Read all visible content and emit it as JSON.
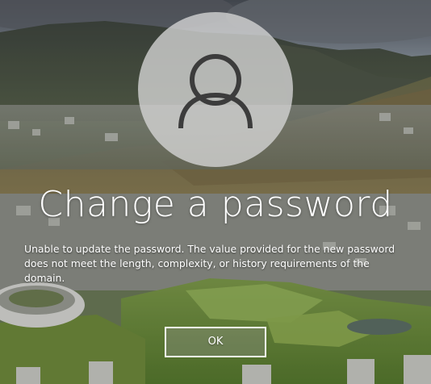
{
  "screen": {
    "title": "Change a password",
    "message": "Unable to update the password. The value provided for the new password does not meet the length, complexity, or history requirements of the domain.",
    "ok_label": "OK"
  },
  "avatar": {
    "icon": "user-icon"
  },
  "colors": {
    "text": "#ffffff",
    "button_border": "#ffffff",
    "avatar_background": "#d6d6d6",
    "avatar_glyph": "#3c3c3c"
  }
}
